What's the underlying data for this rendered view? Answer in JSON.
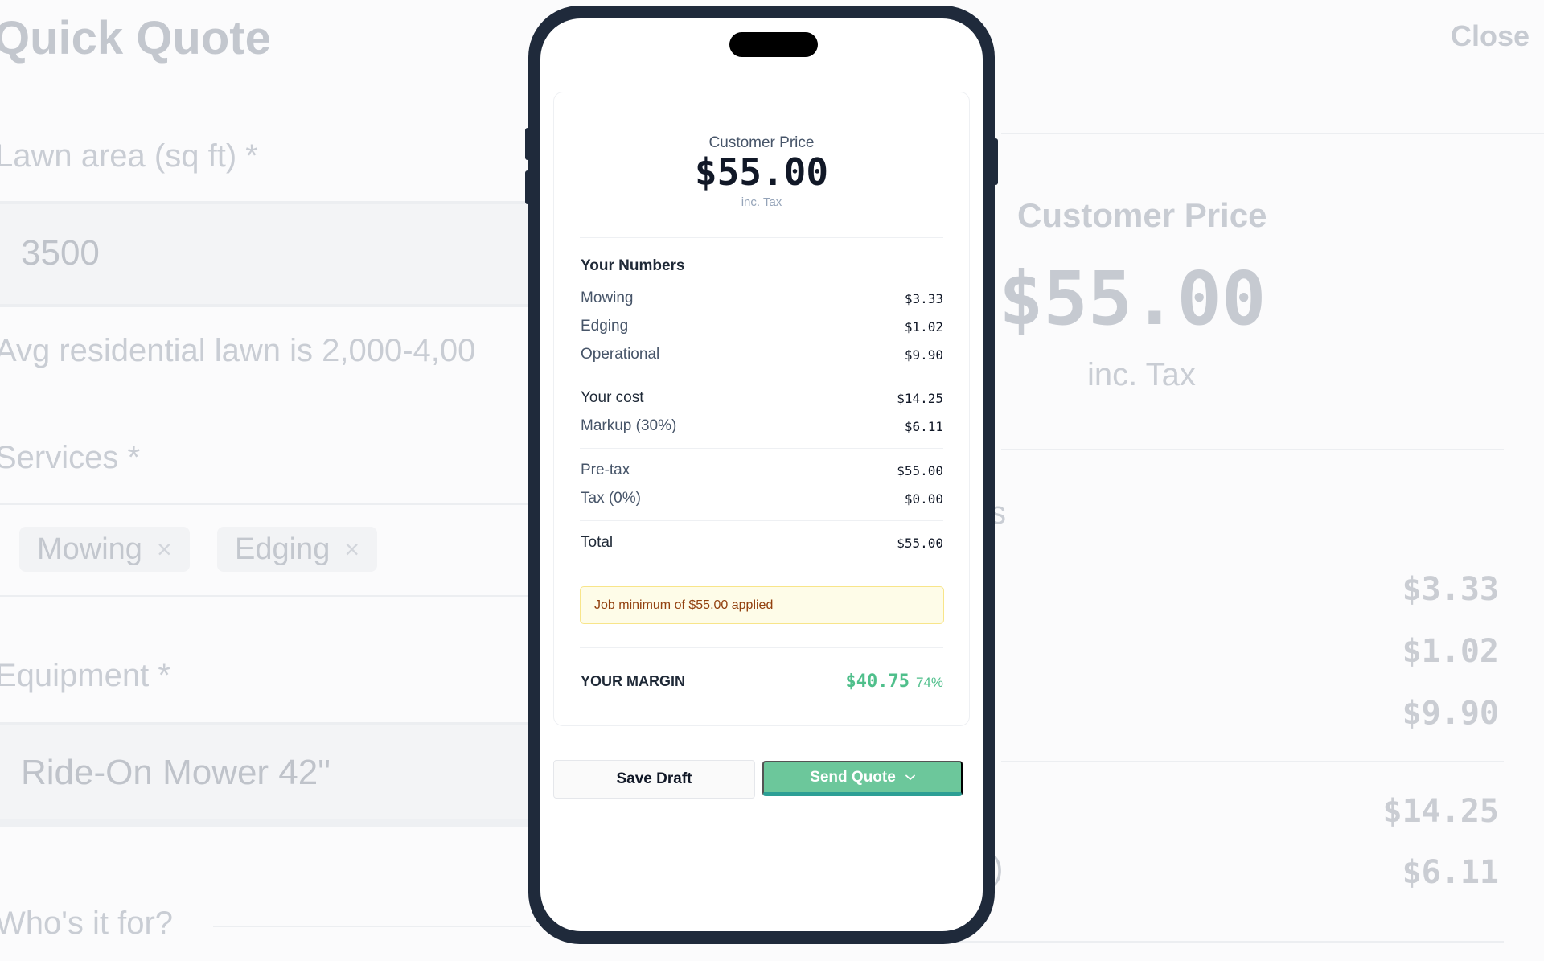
{
  "background": {
    "title": "Quick Quote",
    "close_label": "Close",
    "lawn_area_label": "Lawn area (sq ft) *",
    "lawn_area_value": "3500",
    "lawn_hint": "Avg residential lawn is 2,000-4,00",
    "services_label": "Services *",
    "services": [
      "Mowing",
      "Edging"
    ],
    "remove_icon": "×",
    "equipment_label": "Equipment *",
    "equipment_value": "Ride-On Mower 42\"",
    "customer_label": "Who's it for?",
    "right_price_label": "Customer Price",
    "right_price": "$55.00",
    "right_price_sub": "inc. Tax",
    "right_section_fragment": "s",
    "right_values": [
      "$3.33",
      "$1.02",
      "$9.90",
      "$14.25",
      "$6.11"
    ],
    "right_paren_fragment": ")"
  },
  "quote": {
    "price_label": "Customer Price",
    "price": "$55.00",
    "price_sub": "inc. Tax",
    "section_title": "Your Numbers",
    "costs": [
      {
        "label": "Mowing",
        "value": "$3.33"
      },
      {
        "label": "Edging",
        "value": "$1.02"
      },
      {
        "label": "Operational",
        "value": "$9.90"
      }
    ],
    "subtotal": [
      {
        "label": "Your cost",
        "value": "$14.25"
      },
      {
        "label": "Markup (30%)",
        "value": "$6.11"
      }
    ],
    "tax": [
      {
        "label": "Pre-tax",
        "value": "$55.00"
      },
      {
        "label": "Tax (0%)",
        "value": "$0.00"
      }
    ],
    "total": {
      "label": "Total",
      "value": "$55.00"
    },
    "notice": "Job minimum of $55.00 applied",
    "margin_label": "YOUR MARGIN",
    "margin_value": "$40.75",
    "margin_pct": "74%"
  },
  "actions": {
    "save_label": "Save Draft",
    "send_label": "Send Quote",
    "send_icon": "chevron-down-icon"
  },
  "colors": {
    "accent": "#6cc79b",
    "accent_border": "#2c9f95",
    "margin": "#4fbf8b",
    "phone_frame": "#1f2a3b",
    "notice_bg": "#fefce8"
  }
}
